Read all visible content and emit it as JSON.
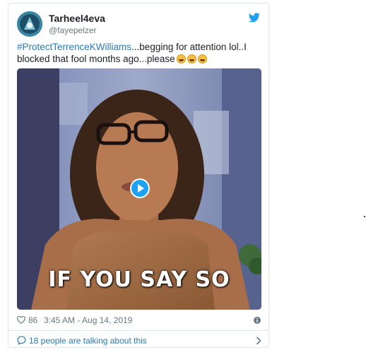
{
  "tweet": {
    "author": {
      "display_name": "Tarheel4eva",
      "handle": "@fayepelzer",
      "avatar_icon": "avatar-image"
    },
    "text": {
      "hashtag": "#ProtectTerrenceKWilliams",
      "body": "...begging for attention lol..I blocked that fool months ago...please",
      "emojis": [
        "face-with-tears-of-joy",
        "face-with-tears-of-joy",
        "face-with-tears-of-joy"
      ]
    },
    "media": {
      "caption": "IF YOU SAY SO",
      "play_icon": "play-icon"
    },
    "meta": {
      "like_count": "86",
      "timestamp": "3:45 AM - Aug 14, 2019",
      "like_icon": "heart-icon",
      "info_icon": "info-icon"
    },
    "talking": {
      "label": "18 people are talking about this",
      "icon": "comment-bubble-icon",
      "chevron_icon": "chevron-right-icon"
    }
  },
  "colors": {
    "link": "#2b7bb9",
    "twitter_blue": "#1da1f2",
    "text": "#1c2022",
    "muted": "#697882",
    "border": "#e1e8ed"
  }
}
